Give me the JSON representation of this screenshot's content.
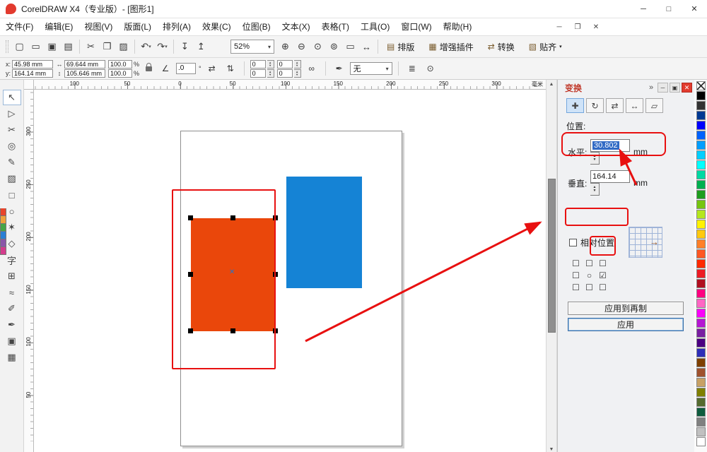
{
  "colors": {
    "annotation-red": "#e81010",
    "orange-rect": "#ea470b",
    "blue-rect": "#1583d5",
    "selection-highlight": "#316ac5",
    "docker-title": "#c0392b",
    "apply-border": "#3a6ea5"
  },
  "glyphs": {
    "caret_down": "▾",
    "spin_up": "▲",
    "spin_down": "▼",
    "scroll_up": "▲",
    "scroll_down": "▼",
    "degree": "°",
    "chevron": "»",
    "center_mark": "✕",
    "arrow_right": "→"
  },
  "title_bar": {
    "title": "CorelDRAW X4（专业版）- [图形1]",
    "minimize": "─",
    "maximize": "□",
    "close": "✕"
  },
  "menu_bar": {
    "items": [
      "文件(F)",
      "编辑(E)",
      "视图(V)",
      "版面(L)",
      "排列(A)",
      "效果(C)",
      "位图(B)",
      "文本(X)",
      "表格(T)",
      "工具(O)",
      "窗口(W)",
      "帮助(H)"
    ],
    "minimize": "─",
    "restore": "❐",
    "close": "✕"
  },
  "toolbar": {
    "file_icons": [
      {
        "name": "new-icon",
        "glyph": "▢"
      },
      {
        "name": "open-icon",
        "glyph": "▭"
      },
      {
        "name": "save-icon",
        "glyph": "▣"
      },
      {
        "name": "print-icon",
        "glyph": "▤"
      }
    ],
    "edit_icons": [
      {
        "name": "cut-icon",
        "glyph": "✂"
      },
      {
        "name": "copy-icon",
        "glyph": "❐"
      },
      {
        "name": "paste-icon",
        "glyph": "▨"
      }
    ],
    "history_icons": [
      {
        "name": "undo-icon",
        "glyph": "↶",
        "caret": "▾"
      },
      {
        "name": "redo-icon",
        "glyph": "↷",
        "caret": "▾"
      }
    ],
    "port_icons": [
      {
        "name": "import-icon",
        "glyph": "↧"
      },
      {
        "name": "export-icon",
        "glyph": "↥"
      }
    ],
    "zoom_value": "52%",
    "zoom_icons": [
      {
        "name": "zoom-in-icon",
        "glyph": "⊕"
      },
      {
        "name": "zoom-out-icon",
        "glyph": "⊖"
      },
      {
        "name": "zoom-selected-icon",
        "glyph": "⊙"
      },
      {
        "name": "zoom-all-icon",
        "glyph": "⊚"
      },
      {
        "name": "zoom-page-icon",
        "glyph": "▭"
      },
      {
        "name": "zoom-width-icon",
        "glyph": "↔"
      }
    ],
    "labeled_buttons": [
      {
        "name": "layout-button",
        "icon": "▤",
        "label": "排版"
      },
      {
        "name": "plugins-button",
        "icon": "▦",
        "label": "增强插件"
      },
      {
        "name": "convert-button",
        "icon": "⇄",
        "label": "转换"
      },
      {
        "name": "snap-button",
        "icon": "▧",
        "label": "贴齐",
        "caret": "▾"
      }
    ]
  },
  "property_bar": {
    "x_label": "x:",
    "x_value": "45.98 mm",
    "y_label": "y:",
    "y_value": "164.14 mm",
    "width_icon": "↔",
    "height_icon": "↕",
    "width_value": "69.644 mm",
    "height_value": "105.646 mm",
    "scale_x": "100.0",
    "scale_y": "100.0",
    "percent": "%",
    "rotation_icon": "∠",
    "rotation_value": ".0",
    "mirror_h_icon": "⇄",
    "mirror_v_icon": "⇅",
    "corner_tl": "0",
    "corner_tr": "0",
    "corner_bl": "0",
    "corner_br": "0",
    "chain_icon": "∞",
    "pen_icon": "✒",
    "outline_value": "无",
    "wrap_icon": "≣",
    "convert_icon": "⊙"
  },
  "rulers": {
    "horizontal": [
      "100",
      "50",
      "0",
      "50",
      "100",
      "150",
      "200",
      "250",
      "300"
    ],
    "unit": "毫米",
    "vertical": [
      "300",
      "250",
      "200",
      "150",
      "100",
      "50"
    ]
  },
  "toolbox": {
    "tools": [
      {
        "name": "pick-tool",
        "glyph": "↖"
      },
      {
        "name": "shape-tool",
        "glyph": "▷"
      },
      {
        "name": "crop-tool",
        "glyph": "✂"
      },
      {
        "name": "zoom-tool",
        "glyph": "◎"
      },
      {
        "name": "freehand-tool",
        "glyph": "✎"
      },
      {
        "name": "smart-fill-tool",
        "glyph": "▨"
      },
      {
        "name": "rectangle-tool",
        "glyph": "□"
      },
      {
        "name": "ellipse-tool",
        "glyph": "○"
      },
      {
        "name": "polygon-tool",
        "glyph": "✶"
      },
      {
        "name": "basic-shapes-tool",
        "glyph": "◇"
      },
      {
        "name": "text-tool",
        "glyph": "字"
      },
      {
        "name": "table-tool",
        "glyph": "⊞"
      },
      {
        "name": "blend-tool",
        "glyph": "≈"
      },
      {
        "name": "eyedropper-tool",
        "glyph": "✐"
      },
      {
        "name": "outline-tool",
        "glyph": "✒"
      },
      {
        "name": "fill-tool",
        "glyph": "▣"
      },
      {
        "name": "interactive-fill-tool",
        "glyph": "▦"
      }
    ]
  },
  "docker": {
    "title": "变换",
    "minimize": "─",
    "float": "▣",
    "close": "✕",
    "transform_buttons": [
      {
        "name": "position-button",
        "glyph": "✚"
      },
      {
        "name": "rotate-button",
        "glyph": "↻"
      },
      {
        "name": "scale-mirror-button",
        "glyph": "⇄"
      },
      {
        "name": "size-button",
        "glyph": "↔"
      },
      {
        "name": "skew-button",
        "glyph": "▱"
      }
    ],
    "section_label": "位置:",
    "horizontal_label": "水平:",
    "horizontal_value": "30.802",
    "vertical_label": "垂直:",
    "vertical_value": "164.14",
    "unit": "mm",
    "relative_label": "相对位置",
    "relative_checked": false,
    "anchor_grid": [
      "☐",
      "☐",
      "☐",
      "☐",
      "○",
      "☑",
      "☐",
      "☐",
      "☐"
    ],
    "apply_duplicate_label": "应用到再制",
    "apply_label": "应用"
  },
  "palette": {
    "colors": [
      "#000000",
      "#333333",
      "#003893",
      "#0000fe",
      "#0062ff",
      "#009eff",
      "#00cfff",
      "#00ffff",
      "#00d9a3",
      "#00b050",
      "#1e9e1e",
      "#76c510",
      "#b5e61d",
      "#fff200",
      "#ffc90e",
      "#ff7f27",
      "#ff5722",
      "#ff2a00",
      "#ed1c24",
      "#b10f1f",
      "#ff0080",
      "#ff66c4",
      "#f902f9",
      "#b517d3",
      "#7a1fa2",
      "#4b0082",
      "#2e2eb8",
      "#7f4000",
      "#a0522d",
      "#c8a165",
      "#808000",
      "#556b2f",
      "#0f5c3e",
      "#808080",
      "#c0c0c0",
      "#ffffff"
    ]
  },
  "left_palette": {
    "colors": [
      "#e8452c",
      "#f0a23c",
      "#46a546",
      "#2a7fd4",
      "#8a56a8",
      "#d43c8c"
    ]
  }
}
